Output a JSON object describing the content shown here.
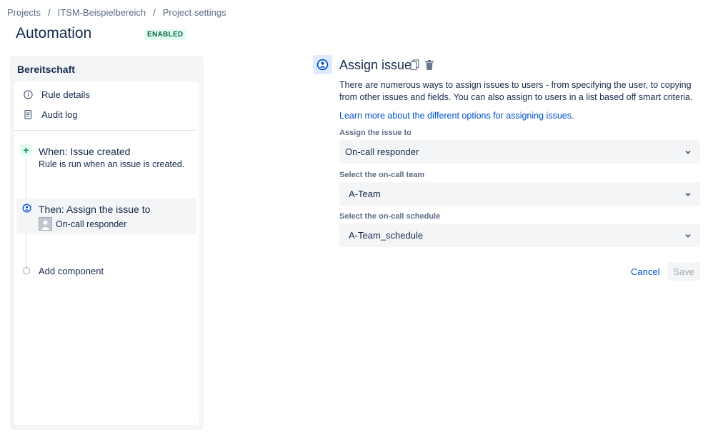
{
  "breadcrumb": {
    "items": [
      "Projects",
      "ITSM-Beispielbereich",
      "Project settings"
    ],
    "separator": "/"
  },
  "page": {
    "title": "Automation",
    "status": "ENABLED"
  },
  "rule": {
    "name": "Bereitschaft",
    "menu": [
      {
        "label": "Rule details",
        "icon": "info-icon"
      },
      {
        "label": "Audit log",
        "icon": "document-icon"
      }
    ],
    "trigger": {
      "title": "When: Issue created",
      "description": "Rule is run when an issue is created.",
      "icon": "plus-icon"
    },
    "action": {
      "title": "Then: Assign the issue to",
      "subtitle": "On-call responder",
      "icon": "person-circle-icon"
    },
    "add_component": "Add component"
  },
  "detail": {
    "title": "Assign issue",
    "description": "There are numerous ways to assign issues to users - from specifying the user, to copying from other issues and fields. You can also assign to users in a list based off smart criteria.",
    "learn_more": "Learn more about the different options for assigning issues.",
    "fields": [
      {
        "label": "Assign the issue to",
        "value": "On-call responder"
      },
      {
        "label": "Select the on-call team",
        "value": "A-Team"
      },
      {
        "label": "Select the on-call schedule",
        "value": "A-Team_schedule"
      }
    ],
    "cancel_label": "Cancel",
    "save_label": "Save"
  },
  "colors": {
    "link": "#0052CC",
    "enabled_bg": "#E3FCEF",
    "enabled_text": "#006644",
    "panel_bg": "#F4F5F7"
  }
}
